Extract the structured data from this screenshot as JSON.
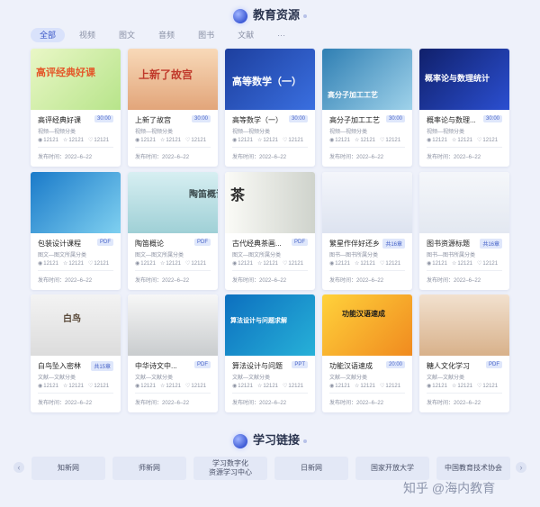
{
  "section1": {
    "title": "教育资源"
  },
  "tabs": [
    "全部",
    "视频",
    "图文",
    "音频",
    "图书",
    "文献",
    "···"
  ],
  "cards": [
    {
      "thumb": "高评经典好课",
      "title": "高评经典好课",
      "badge": "30:00",
      "cat": "视频—视频分类",
      "views": "12121",
      "likes": "12121",
      "favs": "12121",
      "date": "发布时间：2022–6–22"
    },
    {
      "thumb": "上新了故宫",
      "title": "上新了故宫",
      "badge": "30:00",
      "cat": "视频—视频分类",
      "views": "12121",
      "likes": "12121",
      "favs": "12121",
      "date": "发布时间：2022–6–22"
    },
    {
      "thumb": "高等数学（一）",
      "title": "高等数学（一）",
      "badge": "30:00",
      "cat": "视频—视频分类",
      "views": "12121",
      "likes": "12121",
      "favs": "12121",
      "date": "发布时间：2022–6–22"
    },
    {
      "thumb": "高分子加工工艺",
      "title": "高分子加工工艺",
      "badge": "30:00",
      "cat": "视频—视频分类",
      "views": "12121",
      "likes": "12121",
      "favs": "12121",
      "date": "发布时间：2022–6–22"
    },
    {
      "thumb": "概率论与数理统计",
      "title": "概率论与数理...",
      "badge": "30:00",
      "cat": "视频—视频分类",
      "views": "12121",
      "likes": "12121",
      "favs": "12121",
      "date": "发布时间：2022–6–22"
    },
    {
      "thumb": "",
      "title": "包装设计课程",
      "badge": "PDF",
      "cat": "图文—图文所属分类",
      "views": "12121",
      "likes": "12121",
      "favs": "12121",
      "date": "发布时间：2022–6–22"
    },
    {
      "thumb": "陶笛概论",
      "title": "陶笛概论",
      "badge": "PDF",
      "cat": "图文—图文所属分类",
      "views": "12121",
      "likes": "12121",
      "favs": "12121",
      "date": "发布时间：2022–6–22"
    },
    {
      "thumb": "茶",
      "title": "古代经典茶画...",
      "badge": "PDF",
      "cat": "图文—图文所属分类",
      "views": "12121",
      "likes": "12121",
      "favs": "12121",
      "date": "发布时间：2022–6–22"
    },
    {
      "thumb": "",
      "title": "繁星作伴好还乡",
      "badge": "共16章",
      "cat": "图书—图书所属分类",
      "views": "12121",
      "likes": "12121",
      "favs": "12121",
      "date": "发布时间：2022–6–22"
    },
    {
      "thumb": "",
      "title": "图书资源标题",
      "badge": "共16章",
      "cat": "图书—图书所属分类",
      "views": "12121",
      "likes": "12121",
      "favs": "12121",
      "date": "发布时间：2022–6–22"
    },
    {
      "thumb": "白鸟",
      "title": "白鸟坠入密林",
      "badge": "共15章",
      "cat": "文献—文献分类",
      "views": "12121",
      "likes": "12121",
      "favs": "12121",
      "date": "发布时间：2022–6–22"
    },
    {
      "thumb": "",
      "title": "中华诗文中...",
      "badge": "PDF",
      "cat": "文献—文献分类",
      "views": "12121",
      "likes": "12121",
      "favs": "12121",
      "date": "发布时间：2022–6–22"
    },
    {
      "thumb": "算法设计与问题求解",
      "title": "算法设计与问题",
      "badge": "PPT",
      "cat": "文献—文献分类",
      "views": "12121",
      "likes": "12121",
      "favs": "12121",
      "date": "发布时间：2022–6–22"
    },
    {
      "thumb": "功能汉语速成",
      "title": "功能汉语速成",
      "badge": "20:00",
      "cat": "文献—文献分类",
      "views": "12121",
      "likes": "12121",
      "favs": "12121",
      "date": "发布时间：2022–6–22"
    },
    {
      "thumb": "",
      "title": "糖人文化学习",
      "badge": "PDF",
      "cat": "文献—文献分类",
      "views": "12121",
      "likes": "12121",
      "favs": "12121",
      "date": "发布时间：2022–6–22"
    }
  ],
  "section2": {
    "title": "学习链接"
  },
  "links": [
    "知新网",
    "师新网",
    "学习数字化\n资源学习中心",
    "日新网",
    "国家开放大学",
    "中国教育技术协会"
  ],
  "nav": {
    "prev": "‹",
    "next": "›"
  },
  "watermark": "知乎 @海内教育",
  "colors": {
    "accent": "#3a57c7",
    "page_bg": "#eef1fa"
  }
}
